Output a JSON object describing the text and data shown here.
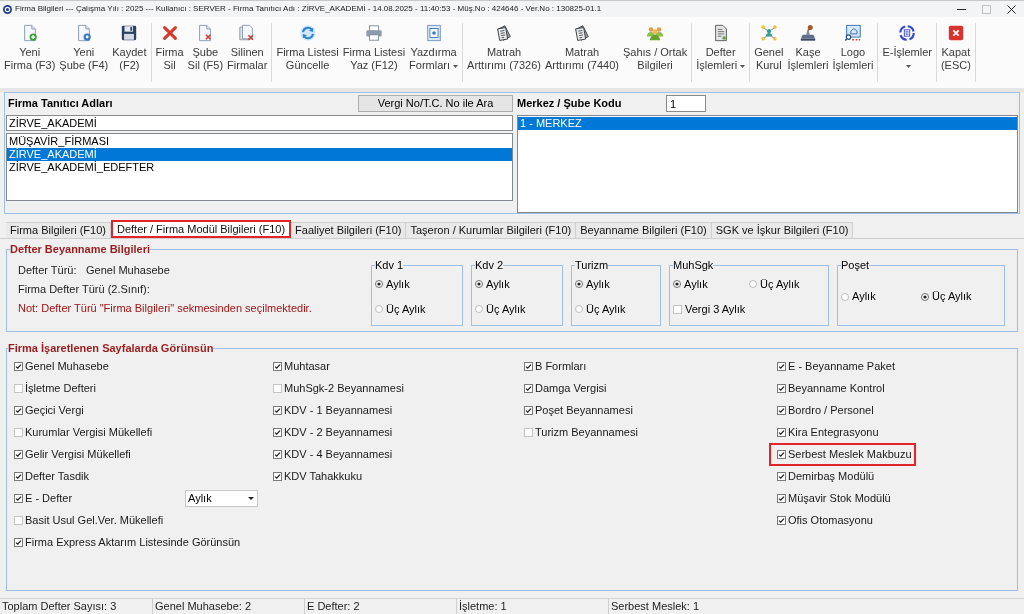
{
  "window": {
    "title": "Firma Bilgileri --- Çalışma Yılı : 2025 --- Kullanıcı : SERVER - Firma Tanıtıcı Adı : ZİRVE_AKADEMİ - 14.08.2025 - 11:40:53 - Müş.No : 424646 - Ver.No : 130825-01.1",
    "maximize_disabled": true
  },
  "toolbar": {
    "groups": [
      {
        "buttons": [
          {
            "lines": [
              "Yeni",
              "Firma (F3)"
            ],
            "dropdown": false
          },
          {
            "lines": [
              "Yeni",
              "Şube (F4)"
            ],
            "dropdown": false
          },
          {
            "lines": [
              "Kaydet",
              "(F2)"
            ],
            "dropdown": false
          }
        ]
      },
      {
        "buttons": [
          {
            "lines": [
              "Firma",
              "Sil"
            ],
            "dropdown": false
          },
          {
            "lines": [
              "Şube",
              "Sil (F5)"
            ],
            "dropdown": false
          },
          {
            "lines": [
              "Silinen",
              "Firmalar"
            ],
            "dropdown": false
          }
        ]
      },
      {
        "buttons": [
          {
            "lines": [
              "Firma Listesi",
              "Güncelle"
            ],
            "dropdown": false
          },
          {
            "lines": [
              "Firma Listesi",
              "Yaz (F12)"
            ],
            "dropdown": false
          },
          {
            "lines": [
              "Yazdırma",
              "Formları"
            ],
            "dropdown": true
          }
        ]
      },
      {
        "buttons": [
          {
            "lines": [
              "Matrah",
              "Arttırımı (7326)"
            ],
            "dropdown": false
          },
          {
            "lines": [
              "Matrah",
              "Arttırımı (7440)"
            ],
            "dropdown": false
          },
          {
            "lines": [
              "Şahıs / Ortak",
              "Bilgileri"
            ],
            "dropdown": false
          }
        ]
      },
      {
        "buttons": [
          {
            "lines": [
              "Defter",
              "İşlemleri"
            ],
            "dropdown": true
          }
        ]
      },
      {
        "buttons": [
          {
            "lines": [
              "Genel",
              "Kurul"
            ],
            "dropdown": false
          },
          {
            "lines": [
              "Kaşe",
              "İşlemleri"
            ],
            "dropdown": false
          },
          {
            "lines": [
              "Logo",
              "İşlemleri"
            ],
            "dropdown": false
          }
        ]
      },
      {
        "buttons": [
          {
            "lines": [
              "E-İşlemler"
            ],
            "dropdown": true
          }
        ]
      },
      {
        "buttons": [
          {
            "lines": [
              "Kapat",
              "(ESC)"
            ],
            "dropdown": false
          }
        ]
      }
    ]
  },
  "companies": {
    "label": "Firma Tanıtıcı Adları",
    "search_button": "Vergi No/T.C. No ile Ara",
    "filter_value": "ZİRVE_AKADEMİ",
    "items": [
      {
        "name": "MÜŞAVİR_FİRMASI",
        "selected": false
      },
      {
        "name": "ZİRVE_AKADEMİ",
        "selected": true
      },
      {
        "name": "ZİRVE_AKADEMİ_EDEFTER",
        "selected": false
      }
    ]
  },
  "branches": {
    "label": "Merkez / Şube Kodu",
    "code_value": "1",
    "items": [
      {
        "name": "1 - MERKEZ",
        "selected": true
      }
    ]
  },
  "tabs": [
    {
      "label": "Firma Bilgileri (F10)",
      "selected": false,
      "highlighted": false
    },
    {
      "label": "Defter / Firma Modül Bilgileri (F10)",
      "selected": true,
      "highlighted": true
    },
    {
      "label": "Faaliyet Bilgileri (F10)",
      "selected": false,
      "highlighted": false
    },
    {
      "label": "Taşeron / Kurumlar Bilgileri (F10)",
      "selected": false,
      "highlighted": false
    },
    {
      "label": "Beyanname Bilgileri (F10)",
      "selected": false,
      "highlighted": false
    },
    {
      "label": "SGK ve İşkur Bilgileri (F10)",
      "selected": false,
      "highlighted": false
    }
  ],
  "defter": {
    "title": "Defter Beyanname Bilgileri",
    "type_label": "Defter Türü:",
    "type_value": "Genel Muhasebe",
    "class_label": "Firma Defter Türü (2.Sınıf):",
    "note": "Not: Defter Türü \"Firma Bilgileri\" sekmesinden seçilmektedir.",
    "periods": [
      {
        "title": "Kdv 1",
        "kind": "vertical",
        "options": [
          {
            "kind": "radio",
            "label": "Aylık",
            "selected": true
          },
          {
            "kind": "radio",
            "label": "Üç Aylık",
            "selected": false
          }
        ]
      },
      {
        "title": "Kdv 2",
        "kind": "vertical",
        "options": [
          {
            "kind": "radio",
            "label": "Aylık",
            "selected": true
          },
          {
            "kind": "radio",
            "label": "Üç Aylık",
            "selected": false
          }
        ]
      },
      {
        "title": "Turizm",
        "kind": "vertical",
        "options": [
          {
            "kind": "radio",
            "label": "Aylık",
            "selected": true
          },
          {
            "kind": "radio",
            "label": "Üç Aylık",
            "selected": false
          }
        ]
      },
      {
        "title": "MuhSgk",
        "kind": "horizontal",
        "options": [
          {
            "kind": "radio",
            "label": "Aylık",
            "selected": true
          },
          {
            "kind": "radio",
            "label": "Üç Aylık",
            "selected": false
          },
          {
            "kind": "checkbox",
            "label": "Vergi 3 Aylık",
            "checked": false
          }
        ]
      },
      {
        "title": "Poşet",
        "kind": "horizontal",
        "options": [
          {
            "kind": "radio",
            "label": "Aylık",
            "selected": false
          },
          {
            "kind": "radio",
            "label": "Üç Aylık",
            "selected": true
          }
        ]
      }
    ]
  },
  "pages": {
    "title": "Firma İşaretlenen Sayfalarda Görünsün",
    "columns": [
      {
        "items": [
          {
            "label": "Genel Muhasebe",
            "checked": true,
            "highlighted": false
          },
          {
            "label": "İşletme Defteri",
            "checked": false,
            "highlighted": false
          },
          {
            "label": "Geçici Vergi",
            "checked": true,
            "highlighted": false
          },
          {
            "label": "Kurumlar Vergisi Mükellefi",
            "checked": false,
            "highlighted": false
          },
          {
            "label": "Gelir Vergisi Mükellefi",
            "checked": true,
            "highlighted": false
          },
          {
            "label": "Defter Tasdik",
            "checked": true,
            "highlighted": false
          },
          {
            "label": "E - Defter",
            "checked": true,
            "highlighted": false,
            "select_value": "Aylık"
          },
          {
            "label": "Basit Usul Gel.Ver. Mükellefi",
            "checked": false,
            "highlighted": false
          },
          {
            "label": "Firma Express Aktarım Listesinde Görünsün",
            "checked": true,
            "highlighted": false
          }
        ]
      },
      {
        "items": [
          {
            "label": "Muhtasar",
            "checked": true,
            "highlighted": false
          },
          {
            "label": "MuhSgk-2 Beyannamesi",
            "checked": false,
            "highlighted": false
          },
          {
            "label": "KDV - 1 Beyannamesi",
            "checked": true,
            "highlighted": false
          },
          {
            "label": "KDV - 2 Beyannamesi",
            "checked": true,
            "highlighted": false
          },
          {
            "label": "KDV - 4 Beyannamesi",
            "checked": true,
            "highlighted": false
          },
          {
            "label": "KDV Tahakkuku",
            "checked": true,
            "highlighted": false
          }
        ]
      },
      {
        "items": [
          {
            "label": "B Formları",
            "checked": true,
            "highlighted": false
          },
          {
            "label": "Damga Vergisi",
            "checked": true,
            "highlighted": false
          },
          {
            "label": "Poşet Beyannamesi",
            "checked": true,
            "highlighted": false
          },
          {
            "label": "Turizm Beyannamesi",
            "checked": false,
            "highlighted": false
          }
        ]
      },
      {
        "items": [
          {
            "label": "E - Beyanname Paket",
            "checked": true,
            "highlighted": false
          },
          {
            "label": "Beyanname Kontrol",
            "checked": true,
            "highlighted": false
          },
          {
            "label": "Bordro / Personel",
            "checked": true,
            "highlighted": false
          },
          {
            "label": "Kira Entegrasyonu",
            "checked": true,
            "highlighted": false
          },
          {
            "label": "Serbest Meslek Makbuzu",
            "checked": true,
            "highlighted": true
          },
          {
            "label": "Demirbaş Modülü",
            "checked": true,
            "highlighted": false
          },
          {
            "label": "Müşavir Stok Modülü",
            "checked": true,
            "highlighted": false
          },
          {
            "label": "Ofis Otomasyonu",
            "checked": true,
            "highlighted": false
          }
        ]
      }
    ]
  },
  "status_bar": [
    "Toplam Defter Sayısı: 3",
    "Genel Muhasebe: 2",
    "E Defter: 2",
    "İşletme: 1",
    "Serbest Meslek: 1"
  ]
}
